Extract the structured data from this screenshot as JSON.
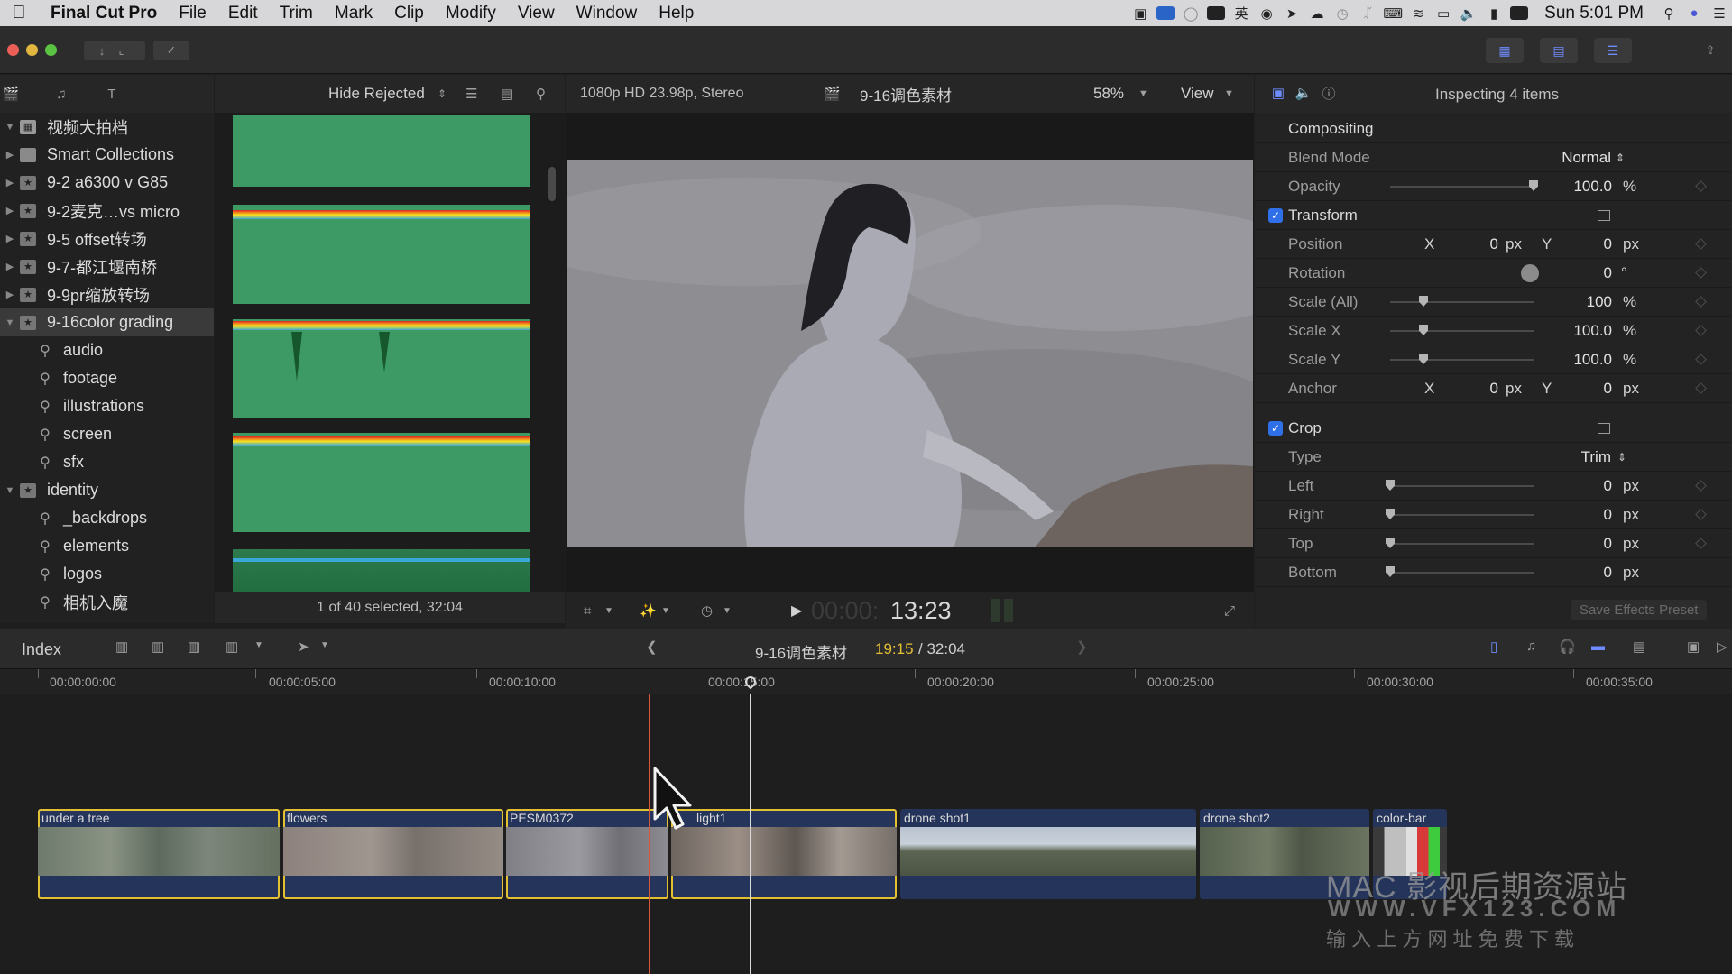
{
  "menubar": {
    "app_name": "Final Cut Pro",
    "menus": [
      "File",
      "Edit",
      "Trim",
      "Mark",
      "Clip",
      "Modify",
      "View",
      "Window",
      "Help"
    ],
    "clock": "Sun 5:01 PM"
  },
  "library": {
    "filter": "Hide Rejected",
    "items": [
      {
        "label": "视频大拍档"
      },
      {
        "label": "Smart Collections"
      },
      {
        "label": "9-2 a6300 v G85"
      },
      {
        "label": "9-2麦克…vs micro"
      },
      {
        "label": "9-5 offset转场"
      },
      {
        "label": "9-7-都江堰南桥"
      },
      {
        "label": "9-9pr缩放转场"
      },
      {
        "label": "9-16color grading"
      },
      {
        "label": "audio"
      },
      {
        "label": "footage"
      },
      {
        "label": "illustrations"
      },
      {
        "label": "screen"
      },
      {
        "label": "sfx"
      },
      {
        "label": "identity"
      },
      {
        "label": "_backdrops"
      },
      {
        "label": "elements"
      },
      {
        "label": "logos"
      },
      {
        "label": "相机入魔"
      }
    ]
  },
  "browser": {
    "status": "1 of 40 selected, 32:04"
  },
  "viewer": {
    "format": "1080p HD 23.98p, Stereo",
    "project_name": "9-16调色素材",
    "zoom": "58%",
    "view_menu": "View",
    "timecode_dim": "00:00:",
    "timecode": "13:23"
  },
  "inspector": {
    "title": "Inspecting 4 items",
    "compositing": "Compositing",
    "blend_mode_label": "Blend Mode",
    "blend_mode_value": "Normal",
    "opacity_label": "Opacity",
    "opacity_value": "100.0",
    "opacity_unit": "%",
    "transform": "Transform",
    "position_label": "Position",
    "axis_x": "X",
    "axis_y": "Y",
    "position_x": "0",
    "position_y": "0",
    "px": "px",
    "rotation_label": "Rotation",
    "rotation_value": "0",
    "rotation_unit": "°",
    "scale_all_label": "Scale (All)",
    "scale_all_value": "100",
    "scale_x_label": "Scale X",
    "scale_x_value": "100.0",
    "scale_y_label": "Scale Y",
    "scale_y_value": "100.0",
    "anchor_label": "Anchor",
    "anchor_x": "0",
    "anchor_y": "0",
    "crop": "Crop",
    "type_label": "Type",
    "type_value": "Trim",
    "left_label": "Left",
    "left_value": "0",
    "right_label": "Right",
    "right_value": "0",
    "top_label": "Top",
    "top_value": "0",
    "bottom_label": "Bottom",
    "bottom_value": "0",
    "save_preset": "Save Effects Preset"
  },
  "timeline": {
    "index": "Index",
    "project_name": "9-16调色素材",
    "position": "19:15",
    "duration": "/ 32:04",
    "ruler": [
      "00:00:00:00",
      "00:00:05:00",
      "00:00:10:00",
      "00:00:15:00",
      "00:00:20:00",
      "00:00:25:00",
      "00:00:30:00",
      "00:00:35:00"
    ],
    "clips": [
      {
        "name": "under a tree",
        "selected": true
      },
      {
        "name": "flowers",
        "selected": true
      },
      {
        "name": "PESM0372",
        "selected": true
      },
      {
        "name": "light1",
        "selected": true
      },
      {
        "name": "drone shot1",
        "selected": false
      },
      {
        "name": "drone shot2",
        "selected": false
      },
      {
        "name": "color-bar",
        "selected": false
      }
    ]
  },
  "watermark": {
    "line1": "MAC 影视后期资源站",
    "line2": "WWW.VFX123.COM",
    "line3": "输 入 上 方 网 址  免 费 下 载"
  },
  "colors": {
    "accent_blue": "#2f6fe8",
    "selection_yellow": "#e4c133",
    "playhead": "#d9d9d9",
    "skimmer": "#e0452c",
    "clip_green": "#3d9a64"
  }
}
